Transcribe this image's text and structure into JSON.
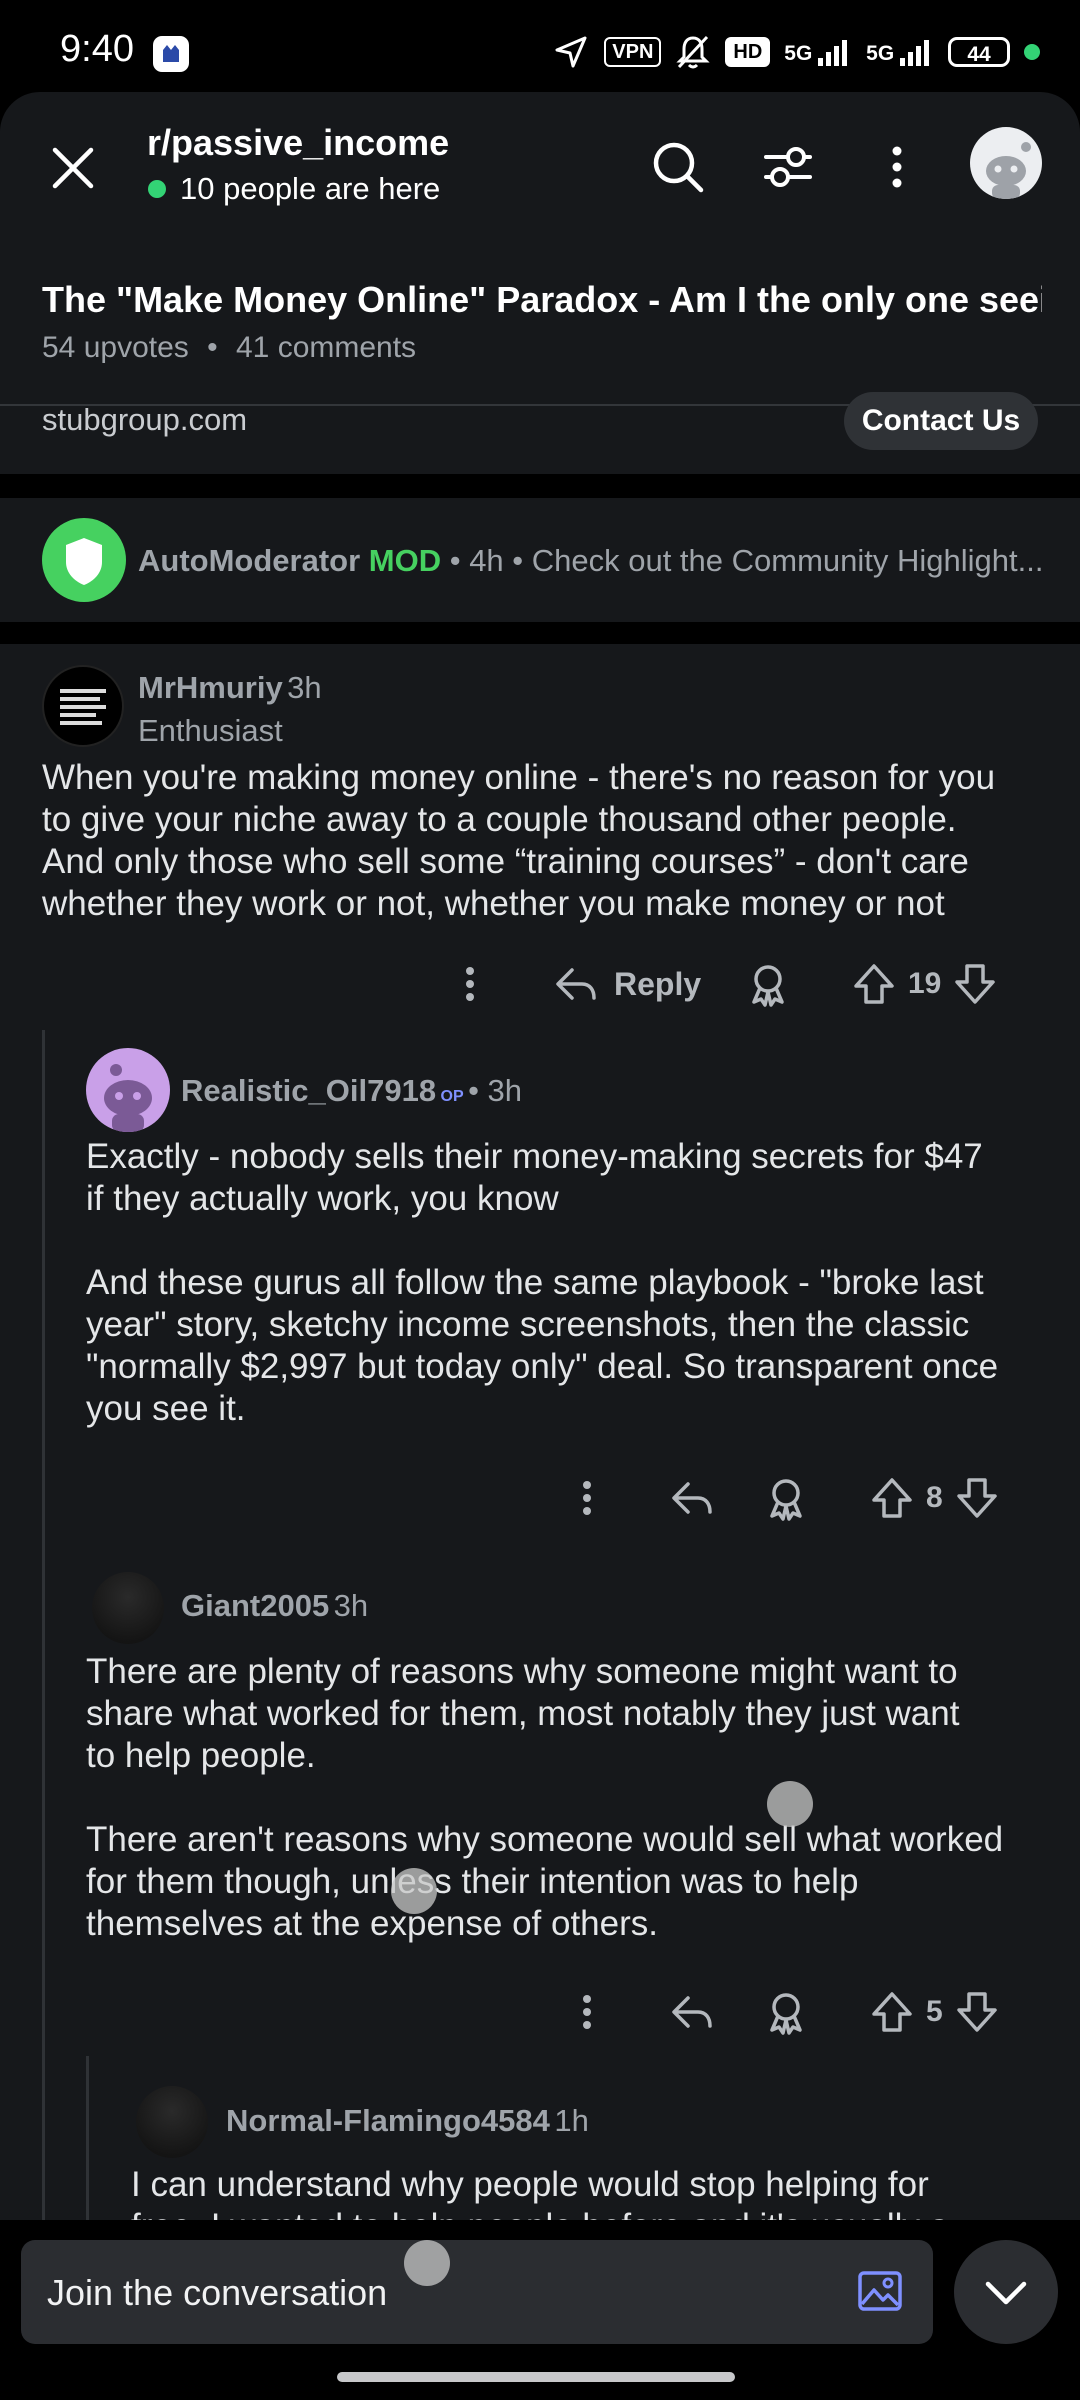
{
  "status_bar": {
    "time": "9:40",
    "vpn_label": "VPN",
    "hd_label": "HD",
    "net1": "5G",
    "net2": "5G",
    "battery": "44",
    "icons": [
      "navigation-icon",
      "vpn-icon",
      "mute-icon",
      "hd-icon",
      "signal-5g-icon",
      "signal-5g-icon",
      "battery-icon"
    ]
  },
  "header": {
    "subreddit": "r/passive_income",
    "presence": "10 people are here",
    "post_title": "The \"Make Money Online\" Paradox - Am I the only one seein...",
    "upvotes": "54 upvotes",
    "comments": "41 comments",
    "bullet": "•"
  },
  "link_strip": {
    "domain": "stubgroup.com",
    "contact_label": "Contact Us"
  },
  "automod": {
    "username": "AutoModerator",
    "mod_badge": "MOD",
    "meta": " • 4h • Check out the Community Highlight..."
  },
  "comments": [
    {
      "username": "MrHmuriy",
      "time": "3h",
      "flair": "Enthusiast",
      "body": "When you're making money online - there's no reason for you\nto give your niche away to a couple thousand other people.\nAnd only those who sell some “training courses” - don't care\nwhether they work or not, whether you make money or not",
      "reply_label": "Reply",
      "score": "19"
    },
    {
      "username": "Realistic_Oil7918",
      "op_badge": "OP",
      "time": "• 3h",
      "body": "Exactly - nobody sells their money-making secrets for $47\nif they actually work, you know\n\nAnd these gurus all follow the same playbook - \"broke last\nyear\" story, sketchy income screenshots, then the classic\n\"normally $2,997 but today only\" deal. So transparent once\nyou see it.",
      "score": "8"
    },
    {
      "username": "Giant2005",
      "time": "3h",
      "body": "There are plenty of reasons why someone might want to\nshare what worked for them, most notably they just want\nto help people.\n\nThere aren't reasons why someone would sell what worked\nfor them though, unless their intention was to help\nthemselves at the expense of others.",
      "score": "5"
    },
    {
      "username": "Normal-Flamingo4584",
      "time": "1h",
      "body": "I can understand why people would stop helping for\nfree. I wanted to help people before and it's usually a"
    }
  ],
  "composer": {
    "placeholder": "Join the conversation"
  },
  "colors": {
    "background": "#16181b",
    "online_green": "#33d375",
    "mod_green": "#46d160",
    "op_blue": "#7f90ff"
  }
}
